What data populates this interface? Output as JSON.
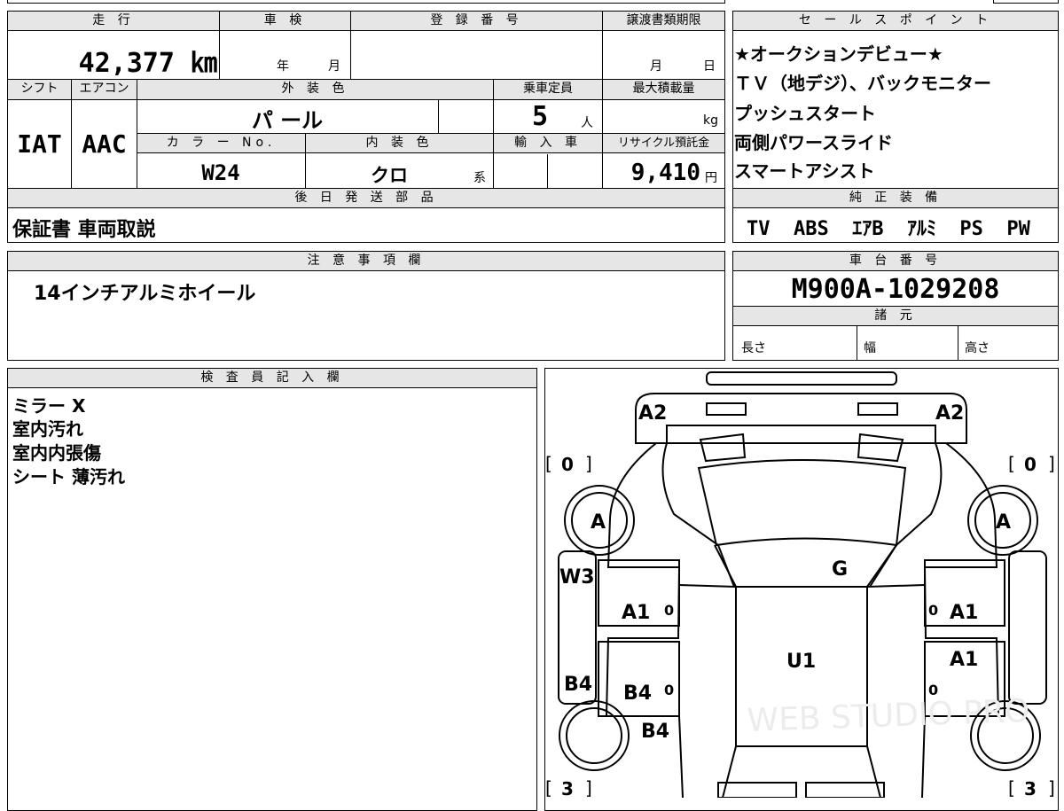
{
  "top_row": {
    "mileage_label": "走 行",
    "mileage_value": "42,377 ㎞",
    "inspection_label": "車 検",
    "inspection_year": "年",
    "inspection_month": "月",
    "reg_label": "登 録 番 号",
    "transfer_label": "譲渡書類期限",
    "transfer_month": "月",
    "transfer_day": "日"
  },
  "spec_row": {
    "shift_label": "シフト",
    "shift_value": "IAT",
    "ac_label": "エアコン",
    "ac_value": "AAC",
    "color_label": "外 装 色",
    "color_value": "パ ール",
    "capacity_label": "乗車定員",
    "capacity_value": "5",
    "capacity_unit": "人",
    "load_label": "最大積載量",
    "load_unit": "kg",
    "color_no_label": "カ ラ ー No.",
    "color_no_value": "W24",
    "interior_label": "内 装 色",
    "interior_value": "クロ",
    "interior_suffix": "系",
    "import_label": "輸 入 車",
    "recycle_label": "リサイクル預託金",
    "recycle_value": "9,410",
    "recycle_unit": "円"
  },
  "later_parts": {
    "label": "後 日 発 送 部 品",
    "value": "保証書 車両取説"
  },
  "notes": {
    "label": "注 意 事 項 欄",
    "value": "14インチアルミホイール"
  },
  "sales": {
    "label": "セ ー ル ス ポ イ ン ト",
    "items": [
      "★オークションデビュー★",
      "ＴＶ（地デジ）、バックモニター",
      "プッシュスタート",
      "両側パワースライド",
      "スマートアシスト"
    ]
  },
  "equipment": {
    "label": "純 正 装 備",
    "value": "TV  ABS  ｴｱB  ｱﾙﾐ  PS  PW"
  },
  "chassis": {
    "label": "車 台 番 号",
    "value": "M900A-1029208"
  },
  "specs": {
    "label": "諸 元",
    "length": "長さ",
    "width": "幅",
    "height": "高さ"
  },
  "inspector": {
    "label": "検 査 員 記 入 欄",
    "lines": [
      "ミラー X",
      "室内汚れ",
      "室内内張傷",
      "シート 薄汚れ"
    ]
  },
  "diagram": {
    "front_left_grade": "0",
    "front_right_grade": "0",
    "rear_left_grade": "3",
    "rear_right_grade": "3",
    "marks": [
      "A2",
      "A2",
      "A",
      "A",
      "W3",
      "G",
      "A1",
      "A1",
      "A1",
      "U1",
      "B4",
      "B4",
      "B4"
    ],
    "zeros": [
      "0",
      "0",
      "0",
      "0"
    ],
    "watermark": "WEB STUDIO PRO"
  }
}
